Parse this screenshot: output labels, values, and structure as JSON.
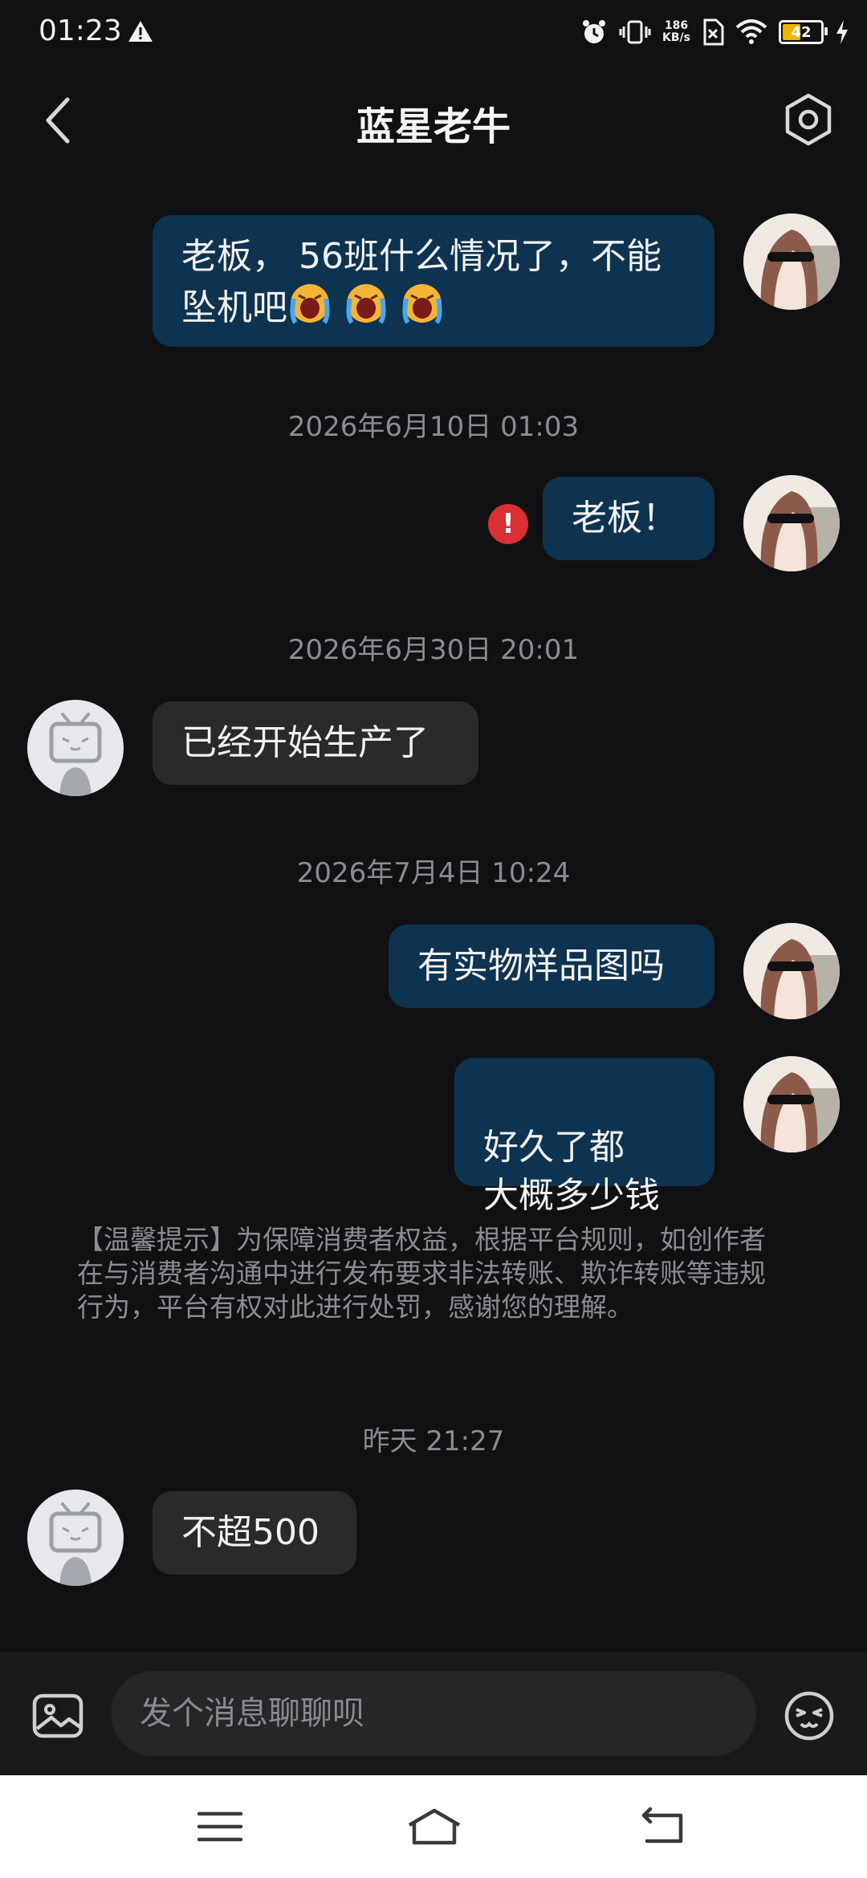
{
  "status_bar": {
    "time": "01:23",
    "net_speed_value": "186",
    "net_speed_unit": "KB/s",
    "battery": "42"
  },
  "header": {
    "title": "蓝星老牛"
  },
  "messages": [
    {
      "type": "sent",
      "text": "老板， 56班什么情况了，不能坠机吧",
      "emojis": 3,
      "emoji_name": "loudly-crying-face"
    },
    {
      "type": "timestamp",
      "text": "2026年6月10日 01:03"
    },
    {
      "type": "sent",
      "text": "老板！",
      "status": "failed"
    },
    {
      "type": "timestamp",
      "text": "2026年6月30日 20:01"
    },
    {
      "type": "received",
      "text": "已经开始生产了"
    },
    {
      "type": "timestamp",
      "text": "2026年7月4日 10:24"
    },
    {
      "type": "sent",
      "text": "有实物样品图吗"
    },
    {
      "type": "sent",
      "text": "好久了都\n大概多少钱"
    },
    {
      "type": "notice",
      "text": "【温馨提示】为保障消费者权益，根据平台规则，如创作者在与消费者沟通中进行发布要求非法转账、欺诈转账等违规行为，平台有权对此进行处罚，感谢您的理解。"
    },
    {
      "type": "timestamp",
      "text": "昨天 21:27"
    },
    {
      "type": "received",
      "text": "不超500"
    }
  ],
  "input": {
    "placeholder": "发个消息聊聊呗"
  },
  "colors": {
    "background": "#111113",
    "sent_bubble": "#0d3350",
    "received_bubble": "#2a2a2d",
    "error": "#d93036",
    "muted_text": "#8c8c90"
  }
}
